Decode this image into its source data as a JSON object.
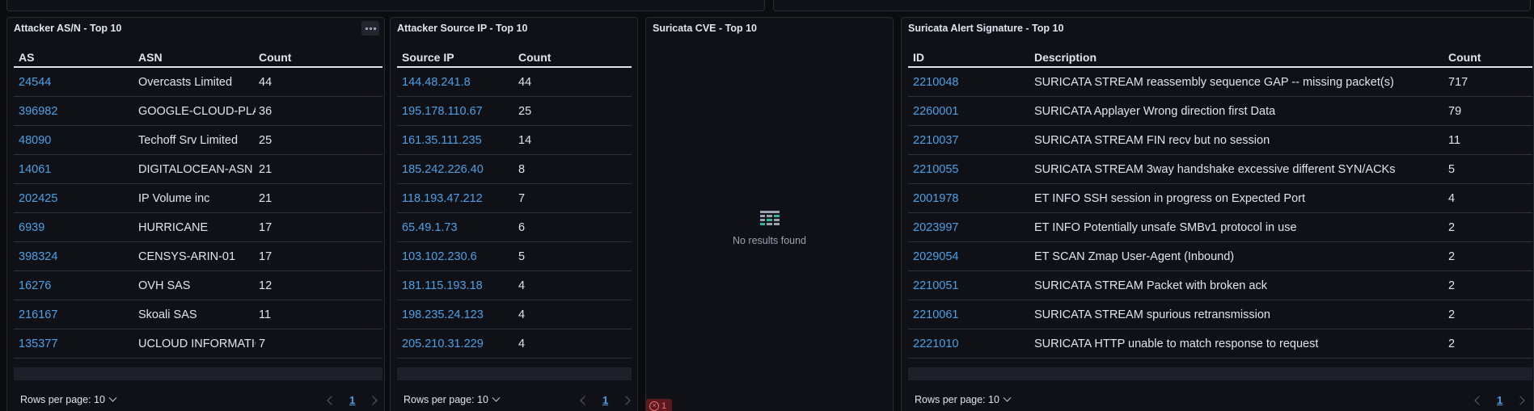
{
  "panels": {
    "asn": {
      "title": "Attacker AS/N - Top 10",
      "columns": [
        "AS",
        "ASN",
        "Count"
      ],
      "rows": [
        {
          "as": "24544",
          "asn": "Overcasts Limited",
          "count": "44"
        },
        {
          "as": "396982",
          "asn": "GOOGLE-CLOUD-PLATFORM",
          "count": "36"
        },
        {
          "as": "48090",
          "asn": "Techoff Srv Limited",
          "count": "25"
        },
        {
          "as": "14061",
          "asn": "DIGITALOCEAN-ASN",
          "count": "21"
        },
        {
          "as": "202425",
          "asn": "IP Volume inc",
          "count": "21"
        },
        {
          "as": "6939",
          "asn": "HURRICANE",
          "count": "17"
        },
        {
          "as": "398324",
          "asn": "CENSYS-ARIN-01",
          "count": "17"
        },
        {
          "as": "16276",
          "asn": "OVH SAS",
          "count": "12"
        },
        {
          "as": "216167",
          "asn": "Skoali SAS",
          "count": "11"
        },
        {
          "as": "135377",
          "asn": "UCLOUD INFORMATION",
          "count": "7"
        }
      ],
      "rows_per_page": "Rows per page: 10",
      "page": "1"
    },
    "srcip": {
      "title": "Attacker Source IP - Top 10",
      "columns": [
        "Source IP",
        "Count"
      ],
      "rows": [
        {
          "ip": "144.48.241.8",
          "count": "44"
        },
        {
          "ip": "195.178.110.67",
          "count": "25"
        },
        {
          "ip": "161.35.111.235",
          "count": "14"
        },
        {
          "ip": "185.242.226.40",
          "count": "8"
        },
        {
          "ip": "118.193.47.212",
          "count": "7"
        },
        {
          "ip": "65.49.1.73",
          "count": "6"
        },
        {
          "ip": "103.102.230.6",
          "count": "5"
        },
        {
          "ip": "181.115.193.18",
          "count": "4"
        },
        {
          "ip": "198.235.24.123",
          "count": "4"
        },
        {
          "ip": "205.210.31.229",
          "count": "4"
        }
      ],
      "rows_per_page": "Rows per page: 10",
      "page": "1"
    },
    "cve": {
      "title": "Suricata CVE - Top 10",
      "empty_text": "No results found",
      "error_count": "1"
    },
    "sig": {
      "title": "Suricata Alert Signature - Top 10",
      "columns": [
        "ID",
        "Description",
        "Count"
      ],
      "rows": [
        {
          "id": "2210048",
          "desc": "SURICATA STREAM reassembly sequence GAP -- missing packet(s)",
          "count": "717"
        },
        {
          "id": "2260001",
          "desc": "SURICATA Applayer Wrong direction first Data",
          "count": "79"
        },
        {
          "id": "2210037",
          "desc": "SURICATA STREAM FIN recv but no session",
          "count": "11"
        },
        {
          "id": "2210055",
          "desc": "SURICATA STREAM 3way handshake excessive different SYN/ACKs",
          "count": "5"
        },
        {
          "id": "2001978",
          "desc": "ET INFO SSH session in progress on Expected Port",
          "count": "4"
        },
        {
          "id": "2023997",
          "desc": "ET INFO Potentially unsafe SMBv1 protocol in use",
          "count": "2"
        },
        {
          "id": "2029054",
          "desc": "ET SCAN Zmap User-Agent (Inbound)",
          "count": "2"
        },
        {
          "id": "2210051",
          "desc": "SURICATA STREAM Packet with broken ack",
          "count": "2"
        },
        {
          "id": "2210061",
          "desc": "SURICATA STREAM spurious retransmission",
          "count": "2"
        },
        {
          "id": "2221010",
          "desc": "SURICATA HTTP unable to match response to request",
          "count": "2"
        }
      ],
      "rows_per_page": "Rows per page: 10",
      "page": "1"
    }
  },
  "colors": {
    "link": "#4ea0e6",
    "background": "#0b0c10",
    "panel": "#0f1117",
    "error": "#f26d6d"
  },
  "icons": [
    "options-menu-icon",
    "chevron-down-icon",
    "chevron-left-icon",
    "chevron-right-icon",
    "table-empty-icon",
    "error-icon"
  ]
}
